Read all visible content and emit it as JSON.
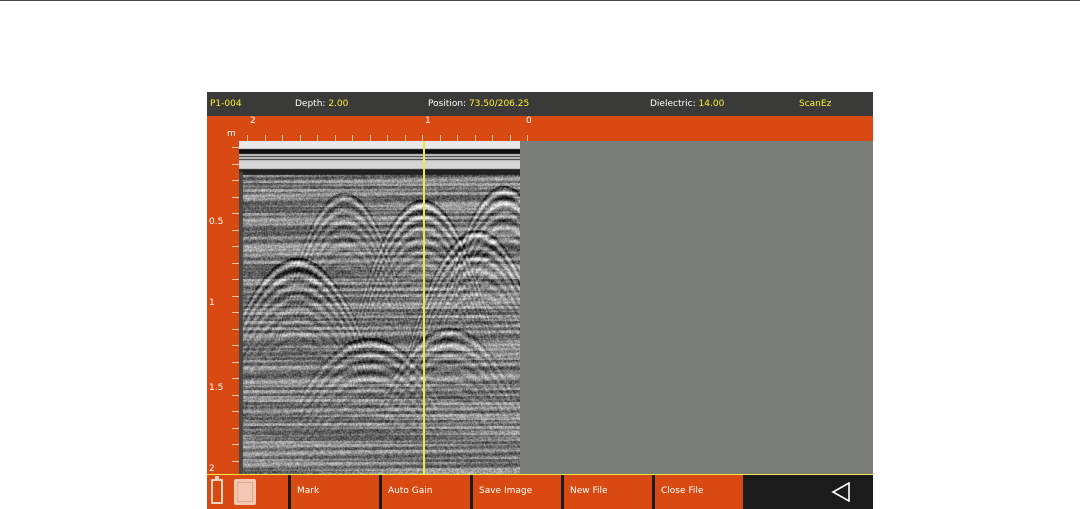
{
  "status_bar": {
    "file_name": "P1-004",
    "depth_label": "Depth: ",
    "depth_value": "2.00",
    "position_label": "Position: ",
    "position_value": "73.50/206.25",
    "dielectric_label": "Dielectric: ",
    "dielectric_value": "14.00",
    "mode": "ScanEz"
  },
  "horizontal_ruler": {
    "labels": [
      "2",
      "1",
      "0"
    ]
  },
  "depth_ruler": {
    "unit": "m",
    "labels": [
      "0.5",
      "1",
      "1.5",
      "2"
    ]
  },
  "toolbar": {
    "buttons": [
      "Mark",
      "Auto Gain",
      "Save Image",
      "New File",
      "Close File"
    ],
    "icons": [
      "battery-icon",
      "storage-card-icon",
      "back-triangle-icon"
    ]
  },
  "colors": {
    "accent_orange": "#d94a12",
    "status_bar_bg": "#3a3a38",
    "value_yellow": "#ffee33",
    "cursor_yellow": "#f0e84a",
    "blank_scan_area": "#7a7d78"
  }
}
